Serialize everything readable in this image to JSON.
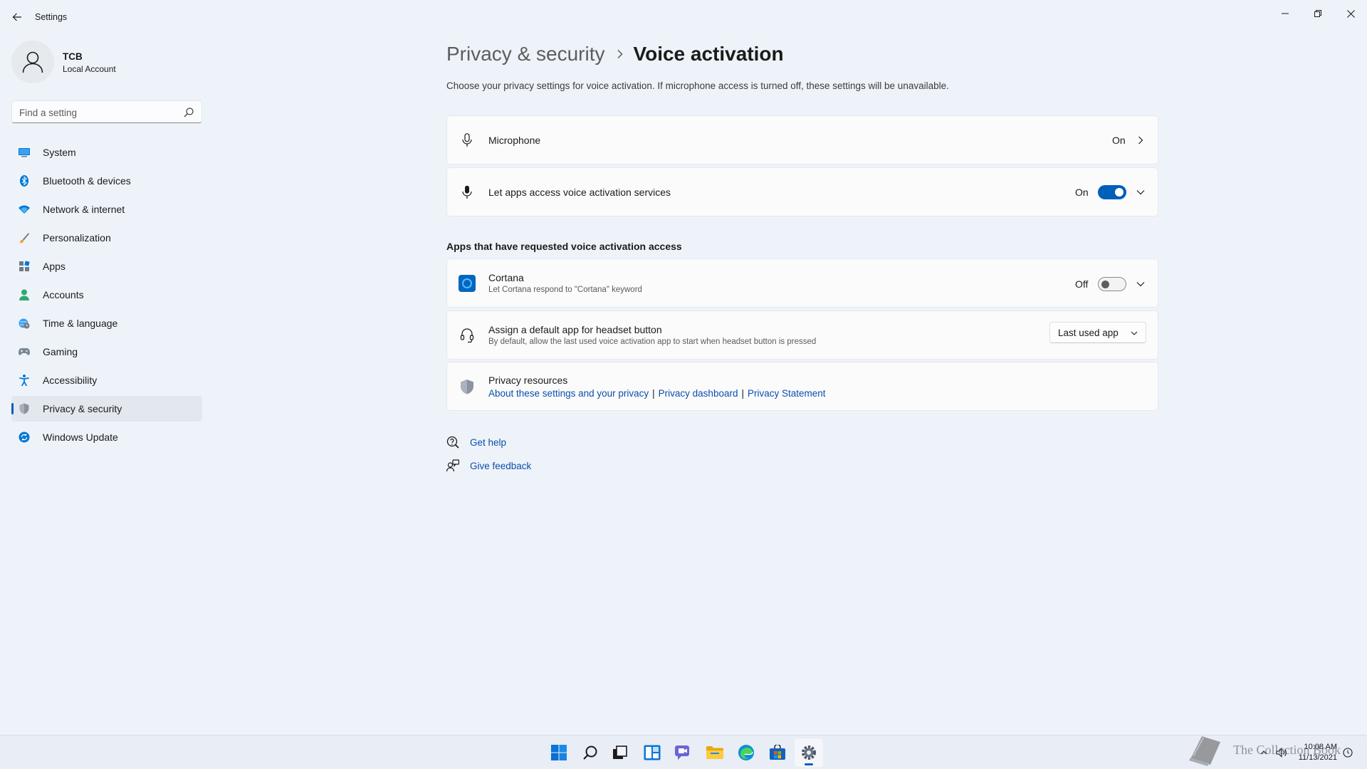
{
  "window": {
    "app_title": "Settings"
  },
  "profile": {
    "name": "TCB",
    "account_type": "Local Account"
  },
  "search": {
    "placeholder": "Find a setting",
    "value": ""
  },
  "sidebar": {
    "items": [
      {
        "label": "System",
        "icon": "monitor-icon",
        "active": false
      },
      {
        "label": "Bluetooth & devices",
        "icon": "bluetooth-icon",
        "active": false
      },
      {
        "label": "Network & internet",
        "icon": "wifi-icon",
        "active": false
      },
      {
        "label": "Personalization",
        "icon": "brush-icon",
        "active": false
      },
      {
        "label": "Apps",
        "icon": "apps-icon",
        "active": false
      },
      {
        "label": "Accounts",
        "icon": "person-icon",
        "active": false
      },
      {
        "label": "Time & language",
        "icon": "globe-clock-icon",
        "active": false
      },
      {
        "label": "Gaming",
        "icon": "gamepad-icon",
        "active": false
      },
      {
        "label": "Accessibility",
        "icon": "accessibility-icon",
        "active": false
      },
      {
        "label": "Privacy & security",
        "icon": "shield-icon",
        "active": true
      },
      {
        "label": "Windows Update",
        "icon": "update-icon",
        "active": false
      }
    ]
  },
  "header": {
    "parent": "Privacy & security",
    "current": "Voice activation",
    "description": "Choose your privacy settings for voice activation. If microphone access is turned off, these settings will be unavailable."
  },
  "settings": {
    "microphone": {
      "title": "Microphone",
      "state": "On"
    },
    "voice_access": {
      "title": "Let apps access voice activation services",
      "state": "On",
      "enabled": true
    }
  },
  "apps_section": {
    "title": "Apps that have requested voice activation access",
    "cortana": {
      "title": "Cortana",
      "subtitle": "Let Cortana respond to \"Cortana\" keyword",
      "state": "Off",
      "enabled": false
    },
    "headset": {
      "title": "Assign a default app for headset button",
      "subtitle": "By default, allow the last used voice activation app to start when headset button is pressed",
      "selected": "Last used app"
    },
    "privacy_resources": {
      "title": "Privacy resources",
      "links": [
        "About these settings and your privacy",
        "Privacy dashboard",
        "Privacy Statement"
      ],
      "separator": "|"
    }
  },
  "help": {
    "get_help": "Get help",
    "give_feedback": "Give feedback"
  },
  "taskbar": {
    "apps": [
      "start-icon",
      "search-icon",
      "task-view-icon",
      "widgets-icon",
      "chat-icon",
      "file-explorer-icon",
      "edge-icon",
      "store-icon",
      "settings-icon"
    ],
    "time": "10:08 AM",
    "date": "11/13/2021"
  },
  "watermark": {
    "text": "The Collection Book"
  },
  "colors": {
    "accent": "#005fb8",
    "background": "#eef3fa",
    "card": "#fbfbfc",
    "link": "#0a4faa"
  }
}
